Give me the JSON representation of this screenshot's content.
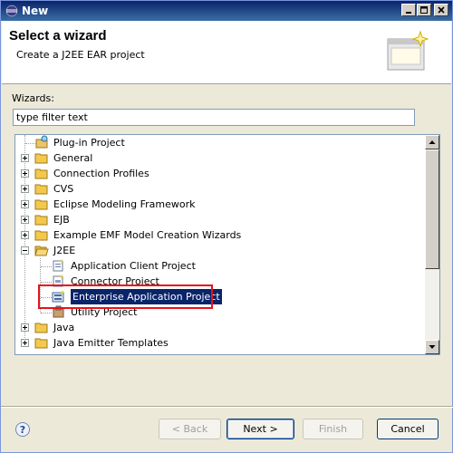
{
  "window": {
    "title": "New"
  },
  "banner": {
    "heading": "Select a wizard",
    "subtitle": "Create a J2EE EAR project"
  },
  "filter": {
    "label": "Wizards:",
    "value": "type filter text"
  },
  "tree": {
    "items": [
      {
        "label": "Plug-in Project",
        "icon": "plugin-project-icon"
      },
      {
        "label": "General",
        "icon": "folder-icon"
      },
      {
        "label": "Connection Profiles",
        "icon": "folder-icon"
      },
      {
        "label": "CVS",
        "icon": "folder-icon"
      },
      {
        "label": "Eclipse Modeling Framework",
        "icon": "folder-icon"
      },
      {
        "label": "EJB",
        "icon": "folder-icon"
      },
      {
        "label": "Example EMF Model Creation Wizards",
        "icon": "folder-icon"
      },
      {
        "label": "J2EE",
        "icon": "folder-open-icon"
      },
      {
        "label": "Application Client Project",
        "icon": "app-client-project-icon"
      },
      {
        "label": "Connector Project",
        "icon": "connector-project-icon"
      },
      {
        "label": "Enterprise Application Project",
        "icon": "enterprise-app-project-icon"
      },
      {
        "label": "Utility Project",
        "icon": "utility-project-icon"
      },
      {
        "label": "Java",
        "icon": "folder-icon"
      },
      {
        "label": "Java Emitter Templates",
        "icon": "folder-icon"
      }
    ]
  },
  "buttons": {
    "back": "< Back",
    "next": "Next >",
    "finish": "Finish",
    "cancel": "Cancel"
  },
  "colors": {
    "selection": "#0a246a",
    "highlight_box": "#e8121a",
    "folder": "#f2c94c"
  }
}
